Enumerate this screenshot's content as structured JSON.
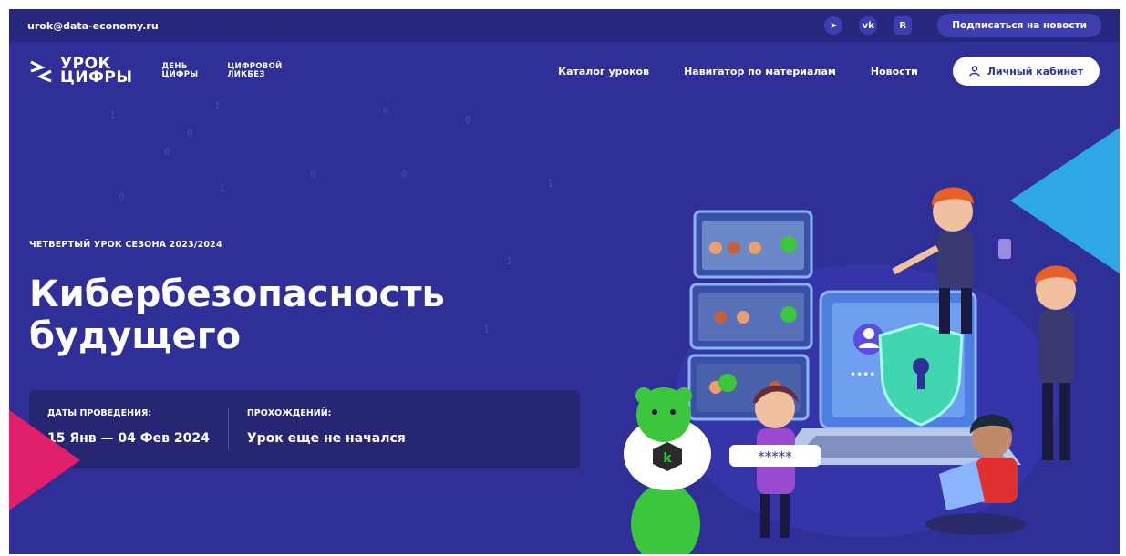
{
  "topbar": {
    "email": "urok@data-economy.ru",
    "social_icons": [
      "telegram-icon",
      "vk-icon",
      "rutube-icon"
    ],
    "social_glyphs": [
      "➤",
      "vk",
      "R"
    ],
    "subscribe_label": "Подписаться на новости"
  },
  "nav": {
    "logo_line1": "УРОК",
    "logo_line2": "ЦИФРЫ",
    "brand2_line1": "ДЕНЬ",
    "brand2_line2": "ЦИФРЫ",
    "brand3_line1": "ЦИФРОВОЙ",
    "brand3_line2": "ЛИКБЕЗ",
    "links": [
      "Каталог уроков",
      "Навигатор по материалам",
      "Новости"
    ],
    "cabinet_label": "Личный кабинет"
  },
  "hero": {
    "season": "ЧЕТВЕРТЫЙ УРОК СЕЗОНА 2023/2024",
    "title_line1": "Кибербезопасность",
    "title_line2": "будущего",
    "dates_label": "ДАТЫ ПРОВЕДЕНИЯ:",
    "dates_value": "15 Янв — 04 Фев 2024",
    "passes_label": "ПРОХОЖДЕНИЙ:",
    "passes_value": "Урок еще не начался"
  },
  "illustration": {
    "password_mask": "*****",
    "login_dots": "••••",
    "bear_badge": "k"
  },
  "colors": {
    "background": "#2f2f97",
    "topbar": "#27287d",
    "card": "#262673",
    "accent_pink": "#e0206b",
    "accent_blue": "#2fa8e8",
    "bear_green": "#3cc63c"
  }
}
